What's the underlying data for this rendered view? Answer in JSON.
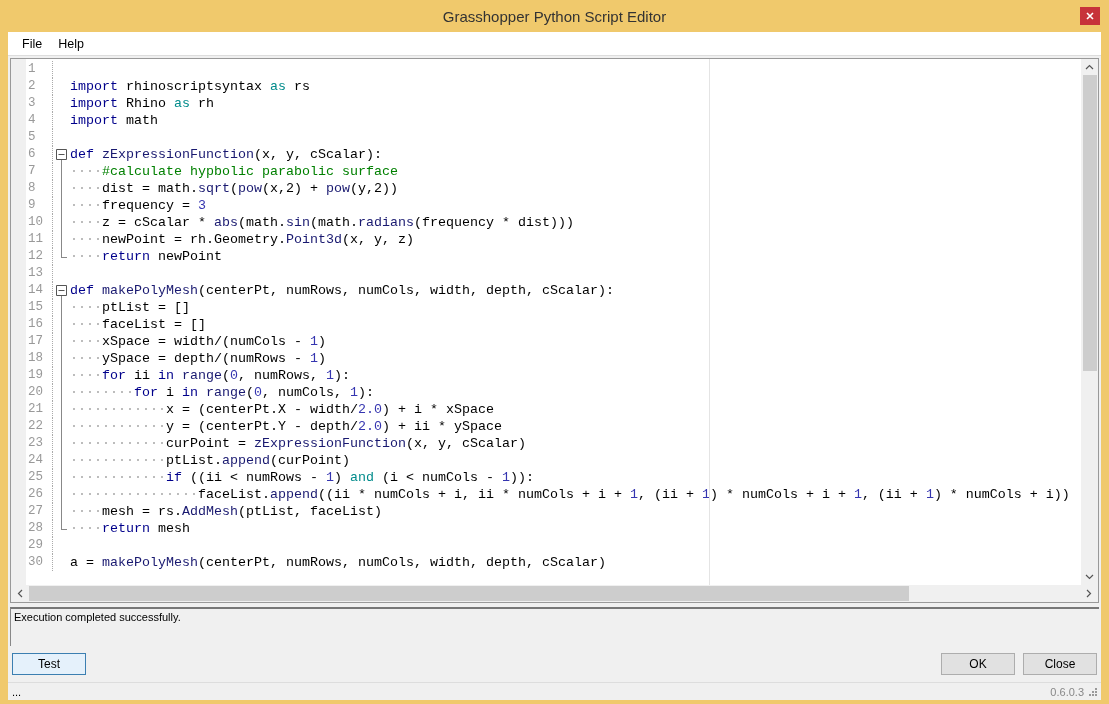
{
  "window": {
    "title": "Grasshopper Python Script Editor"
  },
  "menu": [
    {
      "label": "File"
    },
    {
      "label": "Help"
    }
  ],
  "editor": {
    "lines": [
      {
        "number": "1"
      },
      {
        "number": "2",
        "tokens": [
          {
            "kind": "kw",
            "text": "import"
          },
          {
            "kind": "text",
            "text": " rhinoscriptsyntax "
          },
          {
            "kind": "op",
            "text": "as"
          },
          {
            "kind": "text",
            "text": " rs"
          }
        ]
      },
      {
        "number": "3",
        "tokens": [
          {
            "kind": "kw",
            "text": "import"
          },
          {
            "kind": "text",
            "text": " Rhino "
          },
          {
            "kind": "op",
            "text": "as"
          },
          {
            "kind": "text",
            "text": " rh"
          }
        ]
      },
      {
        "number": "4",
        "tokens": [
          {
            "kind": "kw",
            "text": "import"
          },
          {
            "kind": "text",
            "text": " math"
          }
        ]
      },
      {
        "number": "5"
      },
      {
        "number": "6",
        "expanded": true,
        "tokens": [
          {
            "kind": "kw",
            "text": "def "
          },
          {
            "kind": "name",
            "text": "zExpressionFunction"
          },
          {
            "kind": "text",
            "text": "(x, y, cScalar):"
          }
        ],
        "children": [
          {
            "number": "7",
            "tokens": [
              {
                "kind": "guide",
                "text": "····"
              },
              {
                "kind": "comment",
                "text": "#calculate hypbolic parabolic surface"
              }
            ]
          },
          {
            "number": "8",
            "tokens": [
              {
                "kind": "guide",
                "text": "····"
              },
              {
                "kind": "text",
                "text": "dist = math."
              },
              {
                "kind": "call",
                "text": "sqrt"
              },
              {
                "kind": "text",
                "text": "("
              },
              {
                "kind": "call",
                "text": "pow"
              },
              {
                "kind": "text",
                "text": "(x,2) + "
              },
              {
                "kind": "call",
                "text": "pow"
              },
              {
                "kind": "text",
                "text": "(y,2))"
              }
            ]
          },
          {
            "number": "9",
            "tokens": [
              {
                "kind": "guide",
                "text": "····"
              },
              {
                "kind": "text",
                "text": "frequency = "
              },
              {
                "kind": "num",
                "text": "3"
              }
            ]
          },
          {
            "number": "10",
            "tokens": [
              {
                "kind": "guide",
                "text": "····"
              },
              {
                "kind": "text",
                "text": "z = cScalar * "
              },
              {
                "kind": "call",
                "text": "abs"
              },
              {
                "kind": "text",
                "text": "(math."
              },
              {
                "kind": "call",
                "text": "sin"
              },
              {
                "kind": "text",
                "text": "(math."
              },
              {
                "kind": "call",
                "text": "radians"
              },
              {
                "kind": "text",
                "text": "(frequency * dist)))"
              }
            ]
          },
          {
            "number": "11",
            "tokens": [
              {
                "kind": "guide",
                "text": "····"
              },
              {
                "kind": "text",
                "text": "newPoint = rh.Geometry."
              },
              {
                "kind": "call",
                "text": "Point3d"
              },
              {
                "kind": "text",
                "text": "(x, y, z)"
              }
            ]
          },
          {
            "number": "12",
            "tokens": [
              {
                "kind": "guide",
                "text": "····"
              },
              {
                "kind": "kw",
                "text": "return"
              },
              {
                "kind": "text",
                "text": " newPoint"
              }
            ]
          }
        ]
      },
      {
        "number": "13"
      },
      {
        "number": "14",
        "expanded": true,
        "tokens": [
          {
            "kind": "kw",
            "text": "def "
          },
          {
            "kind": "name",
            "text": "makePolyMesh"
          },
          {
            "kind": "text",
            "text": "(centerPt, numRows, numCols, width, depth, cScalar):"
          }
        ],
        "children": [
          {
            "number": "15",
            "tokens": [
              {
                "kind": "guide",
                "text": "····"
              },
              {
                "kind": "text",
                "text": "ptList = []"
              }
            ]
          },
          {
            "number": "16",
            "tokens": [
              {
                "kind": "guide",
                "text": "····"
              },
              {
                "kind": "text",
                "text": "faceList = []"
              }
            ]
          },
          {
            "number": "17",
            "tokens": [
              {
                "kind": "guide",
                "text": "····"
              },
              {
                "kind": "text",
                "text": "xSpace = width/(numCols - "
              },
              {
                "kind": "num",
                "text": "1"
              },
              {
                "kind": "text",
                "text": ")"
              }
            ]
          },
          {
            "number": "18",
            "tokens": [
              {
                "kind": "guide",
                "text": "····"
              },
              {
                "kind": "text",
                "text": "ySpace = depth/(numRows - "
              },
              {
                "kind": "num",
                "text": "1"
              },
              {
                "kind": "text",
                "text": ")"
              }
            ]
          },
          {
            "number": "19",
            "tokens": [
              {
                "kind": "guide",
                "text": "····"
              },
              {
                "kind": "kw",
                "text": "for"
              },
              {
                "kind": "text",
                "text": " ii "
              },
              {
                "kind": "kw",
                "text": "in "
              },
              {
                "kind": "call",
                "text": "range"
              },
              {
                "kind": "text",
                "text": "("
              },
              {
                "kind": "num",
                "text": "0"
              },
              {
                "kind": "text",
                "text": ", numRows, "
              },
              {
                "kind": "num",
                "text": "1"
              },
              {
                "kind": "text",
                "text": "):"
              }
            ]
          },
          {
            "number": "20",
            "tokens": [
              {
                "kind": "guide",
                "text": "········"
              },
              {
                "kind": "kw",
                "text": "for"
              },
              {
                "kind": "text",
                "text": " i "
              },
              {
                "kind": "kw",
                "text": "in "
              },
              {
                "kind": "call",
                "text": "range"
              },
              {
                "kind": "text",
                "text": "("
              },
              {
                "kind": "num",
                "text": "0"
              },
              {
                "kind": "text",
                "text": ", numCols, "
              },
              {
                "kind": "num",
                "text": "1"
              },
              {
                "kind": "text",
                "text": "):"
              }
            ]
          },
          {
            "number": "21",
            "tokens": [
              {
                "kind": "guide",
                "text": "············"
              },
              {
                "kind": "text",
                "text": "x = (centerPt.X - width/"
              },
              {
                "kind": "num",
                "text": "2.0"
              },
              {
                "kind": "text",
                "text": ") + i * xSpace"
              }
            ]
          },
          {
            "number": "22",
            "tokens": [
              {
                "kind": "guide",
                "text": "············"
              },
              {
                "kind": "text",
                "text": "y = (centerPt.Y - depth/"
              },
              {
                "kind": "num",
                "text": "2.0"
              },
              {
                "kind": "text",
                "text": ") + ii * ySpace"
              }
            ]
          },
          {
            "number": "23",
            "tokens": [
              {
                "kind": "guide",
                "text": "············"
              },
              {
                "kind": "text",
                "text": "curPoint = "
              },
              {
                "kind": "name",
                "text": "zExpressionFunction"
              },
              {
                "kind": "text",
                "text": "(x, y, cScalar)"
              }
            ]
          },
          {
            "number": "24",
            "tokens": [
              {
                "kind": "guide",
                "text": "············"
              },
              {
                "kind": "text",
                "text": "ptList."
              },
              {
                "kind": "call",
                "text": "append"
              },
              {
                "kind": "text",
                "text": "(curPoint)"
              }
            ]
          },
          {
            "number": "25",
            "tokens": [
              {
                "kind": "guide",
                "text": "············"
              },
              {
                "kind": "kw",
                "text": "if"
              },
              {
                "kind": "text",
                "text": " ((ii < numRows - "
              },
              {
                "kind": "num",
                "text": "1"
              },
              {
                "kind": "text",
                "text": ") "
              },
              {
                "kind": "op",
                "text": "and"
              },
              {
                "kind": "text",
                "text": " (i < numCols - "
              },
              {
                "kind": "num",
                "text": "1"
              },
              {
                "kind": "text",
                "text": ")):"
              }
            ]
          },
          {
            "number": "26",
            "tokens": [
              {
                "kind": "guide",
                "text": "················"
              },
              {
                "kind": "text",
                "text": "faceList."
              },
              {
                "kind": "call",
                "text": "append"
              },
              {
                "kind": "text",
                "text": "((ii * numCols + i, ii * numCols + i + "
              },
              {
                "kind": "num",
                "text": "1"
              },
              {
                "kind": "text",
                "text": ", (ii + "
              },
              {
                "kind": "num",
                "text": "1"
              },
              {
                "kind": "text",
                "text": ") * numCols + i + "
              },
              {
                "kind": "num",
                "text": "1"
              },
              {
                "kind": "text",
                "text": ", (ii + "
              },
              {
                "kind": "num",
                "text": "1"
              },
              {
                "kind": "text",
                "text": ") * numCols + i))"
              }
            ]
          },
          {
            "number": "27",
            "tokens": [
              {
                "kind": "guide",
                "text": "····"
              },
              {
                "kind": "text",
                "text": "mesh = rs."
              },
              {
                "kind": "call",
                "text": "AddMesh"
              },
              {
                "kind": "text",
                "text": "(ptList, faceList)"
              }
            ]
          },
          {
            "number": "28",
            "tokens": [
              {
                "kind": "guide",
                "text": "····"
              },
              {
                "kind": "kw",
                "text": "return"
              },
              {
                "kind": "text",
                "text": " mesh"
              }
            ]
          }
        ]
      },
      {
        "number": "29"
      },
      {
        "number": "30",
        "tokens": [
          {
            "kind": "text",
            "text": "a = "
          },
          {
            "kind": "name",
            "text": "makePolyMesh"
          },
          {
            "kind": "text",
            "text": "(centerPt, numRows, numCols, width, depth, cScalar)"
          }
        ]
      }
    ]
  },
  "output": {
    "message": "Execution completed successfully."
  },
  "buttons_left": [
    {
      "label": "Test",
      "focused": true
    }
  ],
  "buttons_right": [
    {
      "label": "OK",
      "focused": false
    },
    {
      "label": "Close",
      "focused": false
    }
  ],
  "status_bar": {
    "left": "...",
    "version": "0.6.0.3"
  }
}
